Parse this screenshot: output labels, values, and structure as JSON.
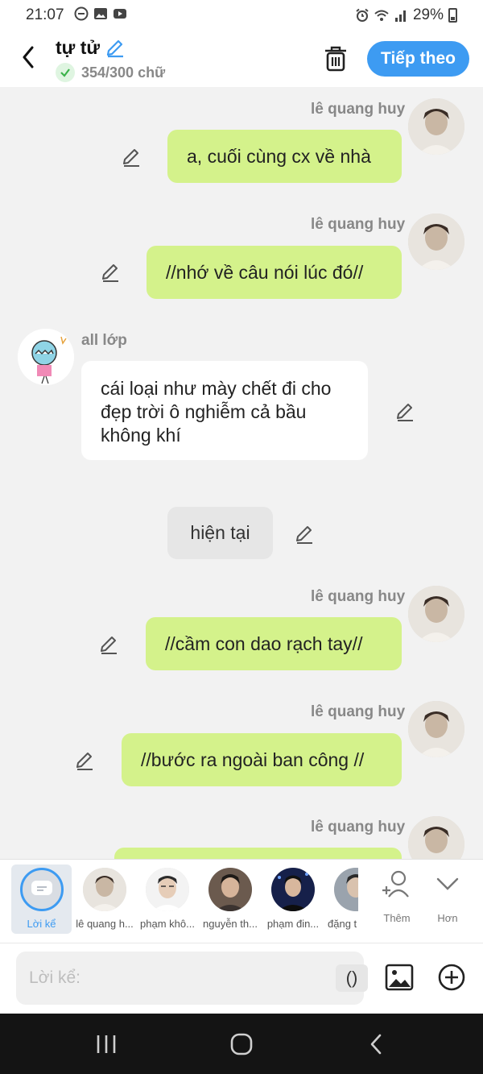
{
  "status": {
    "time": "21:07",
    "battery": "29%"
  },
  "header": {
    "title": "tự tử",
    "count": "354/300 chữ",
    "next_label": "Tiếp theo"
  },
  "messages": [
    {
      "sender": "lê quang huy",
      "text": "a, cuối cùng cx về nhà"
    },
    {
      "sender": "lê quang huy",
      "text": "//nhớ về câu nói lúc đó//"
    },
    {
      "sender": "all lớp",
      "text": "cái loại như mày chết đi cho đẹp trời ô nghiễm cả bầu không khí"
    },
    {
      "text": "hiện tại"
    },
    {
      "sender": "lê quang huy",
      "text": "//cầm con dao rạch tay//"
    },
    {
      "sender": "lê quang huy",
      "text": "//bước ra ngoài ban công //"
    },
    {
      "sender": "lê quang huy",
      "text": ""
    }
  ],
  "characters": [
    {
      "label": "Lời kể"
    },
    {
      "label": "lê quang h..."
    },
    {
      "label": "phạm khô..."
    },
    {
      "label": "nguyễn th..."
    },
    {
      "label": "phạm đin..."
    },
    {
      "label": "đặng t"
    }
  ],
  "tools": {
    "add": "Thêm",
    "more": "Hơn"
  },
  "input": {
    "placeholder": "Lời kể:",
    "paren": "()"
  },
  "colors": {
    "accent": "#3d9bf2",
    "bubble_green": "#d4f28b"
  }
}
